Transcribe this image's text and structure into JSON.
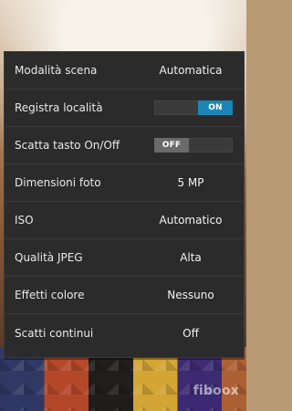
{
  "settings": {
    "items": [
      {
        "label": "Modalità scena",
        "value": "Automatica"
      },
      {
        "label": "Registra località",
        "toggle": "ON"
      },
      {
        "label": "Scatta tasto On/Off",
        "toggle": "OFF"
      },
      {
        "label": "Dimensioni foto",
        "value": "5 MP"
      },
      {
        "label": "ISO",
        "value": "Automatico"
      },
      {
        "label": "Qualità JPEG",
        "value": "Alta"
      },
      {
        "label": "Effetti colore",
        "value": "Nessuno"
      },
      {
        "label": "Scatti continui",
        "value": "Off"
      }
    ]
  },
  "watermark": "fiboox",
  "colors": {
    "panel_bg": "#2b2b2b",
    "divider": "#3b3b3b",
    "toggle_on": "#1a86b6",
    "toggle_off": "#6a6a6a",
    "text": "#e9e9e9"
  },
  "icons": {
    "watermark": "fiboox-logo"
  }
}
